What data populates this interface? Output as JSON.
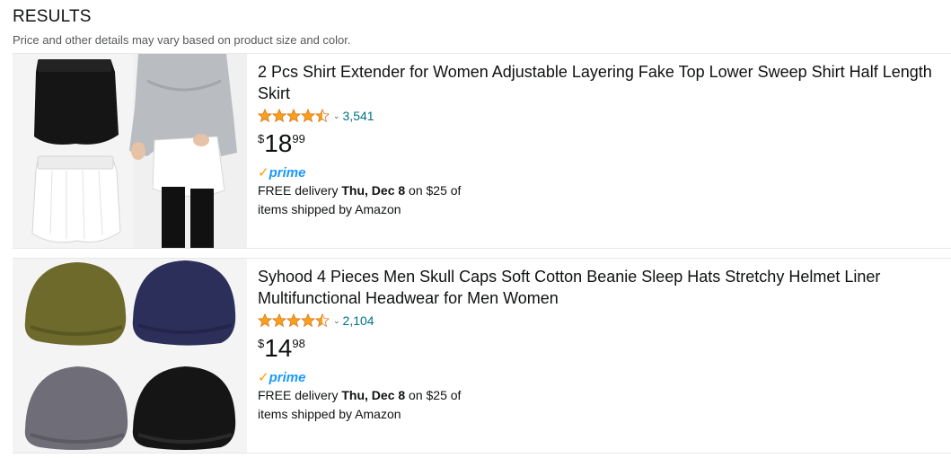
{
  "header": {
    "title": "RESULTS",
    "subtitle": "Price and other details may vary based on product size and color."
  },
  "products": [
    {
      "title": "2 Pcs Shirt Extender for Women Adjustable Layering Fake Top Lower Sweep Shirt Half Length Skirt",
      "rating": 4.5,
      "rating_count": "3,541",
      "price_symbol": "$",
      "price_whole": "18",
      "price_fraction": "99",
      "badge": "prime",
      "delivery_prefix": "FREE delivery ",
      "delivery_date": "Thu, Dec 8",
      "delivery_suffix": " on $25 of items shipped by Amazon",
      "image": "shirt-extender-image"
    },
    {
      "title": "Syhood 4 Pieces Men Skull Caps Soft Cotton Beanie Sleep Hats Stretchy Helmet Liner Multifunctional Headwear for Men Women",
      "rating": 4.5,
      "rating_count": "2,104",
      "price_symbol": "$",
      "price_whole": "14",
      "price_fraction": "98",
      "badge": "prime",
      "delivery_prefix": "FREE delivery ",
      "delivery_date": "Thu, Dec 8",
      "delivery_suffix": " on $25 of items shipped by Amazon",
      "image": "skull-caps-image"
    }
  ],
  "colors": {
    "star": "#de7921",
    "link": "#007185",
    "prime_check": "#ff9900",
    "prime_text": "#1a98ff"
  },
  "icons": {
    "star": "star-icon",
    "chevron": "chevron-down-icon",
    "prime": "prime-check-icon"
  }
}
